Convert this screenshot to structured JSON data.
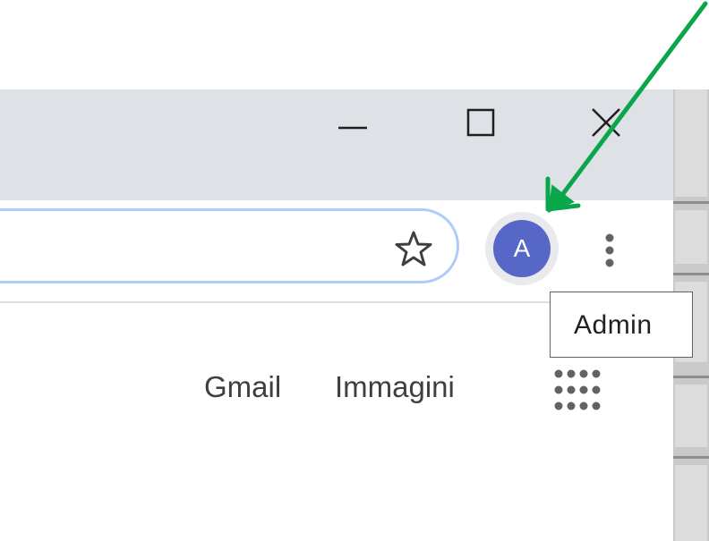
{
  "browser": {
    "window_controls": {
      "minimize_icon": "minimize-icon",
      "maximize_icon": "maximize-icon",
      "close_icon": "close-icon"
    },
    "toolbar": {
      "bookmark_icon": "star-outline-icon",
      "profile": {
        "initial": "A",
        "color": "#5667c7"
      },
      "menu_icon": "vertical-dots-icon"
    },
    "tooltip": {
      "text": "Admin"
    }
  },
  "page": {
    "links": {
      "gmail": "Gmail",
      "images": "Immagini"
    },
    "apps_icon": "apps-grid-icon"
  },
  "annotation": {
    "arrow_color": "#0aa64b",
    "arrow_icon": "arrow-icon"
  }
}
